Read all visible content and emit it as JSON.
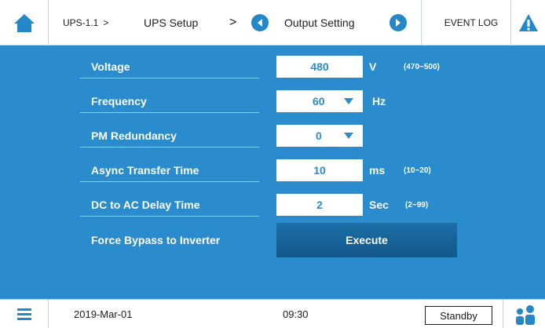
{
  "header": {
    "device_id": "UPS-1.1",
    "device_sep": ">",
    "section": "UPS Setup",
    "section_sep": ">",
    "page": "Output Setting",
    "event_log": "EVENT LOG",
    "icons": {
      "home": "home-icon",
      "prev": "arrow-left-circle-icon",
      "next": "arrow-right-circle-icon",
      "alert": "warning-icon"
    }
  },
  "settings": [
    {
      "label": "Voltage",
      "value": "480",
      "unit": "V",
      "range": "(470~500)"
    },
    {
      "label": "Frequency",
      "value": "60",
      "unit": "Hz",
      "range": ""
    },
    {
      "label": "PM Redundancy",
      "value": "0",
      "unit": "",
      "range": ""
    },
    {
      "label": "Async Transfer Time",
      "value": "10",
      "unit": "ms",
      "range": "(10~20)"
    },
    {
      "label": "DC to AC Delay Time",
      "value": "2",
      "unit": "Sec",
      "range": "(2~99)"
    }
  ],
  "bypass": {
    "label": "Force Bypass to Inverter",
    "button": "Execute"
  },
  "footer": {
    "date": "2019-Mar-01",
    "time": "09:30",
    "status": "Standby",
    "icons": {
      "menu": "menu-icon",
      "user": "users-icon"
    }
  },
  "colors": {
    "panel": "#2a8ccd",
    "accent": "#2387c8",
    "button": "#12578a"
  }
}
